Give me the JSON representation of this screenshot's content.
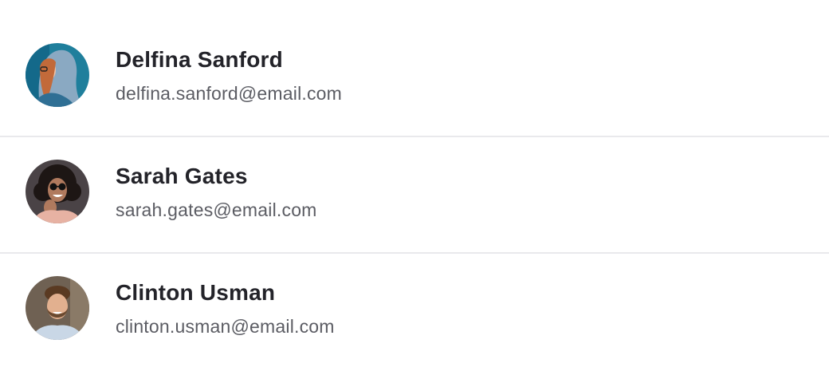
{
  "contacts": [
    {
      "name": "Delfina Sanford",
      "email": "delfina.sanford@email.com",
      "avatar_bg": "#1f7f9c",
      "avatar_accent": "#8aa9c2"
    },
    {
      "name": "Sarah Gates",
      "email": "sarah.gates@email.com",
      "avatar_bg": "#4a4346",
      "avatar_accent": "#2a1f1c"
    },
    {
      "name": "Clinton Usman",
      "email": "clinton.usman@email.com",
      "avatar_bg": "#6f6153",
      "avatar_accent": "#c9d7e6"
    }
  ],
  "colors": {
    "name_text": "#232329",
    "email_text": "#5b5c63",
    "divider": "#e9e9ec",
    "background": "#ffffff"
  }
}
